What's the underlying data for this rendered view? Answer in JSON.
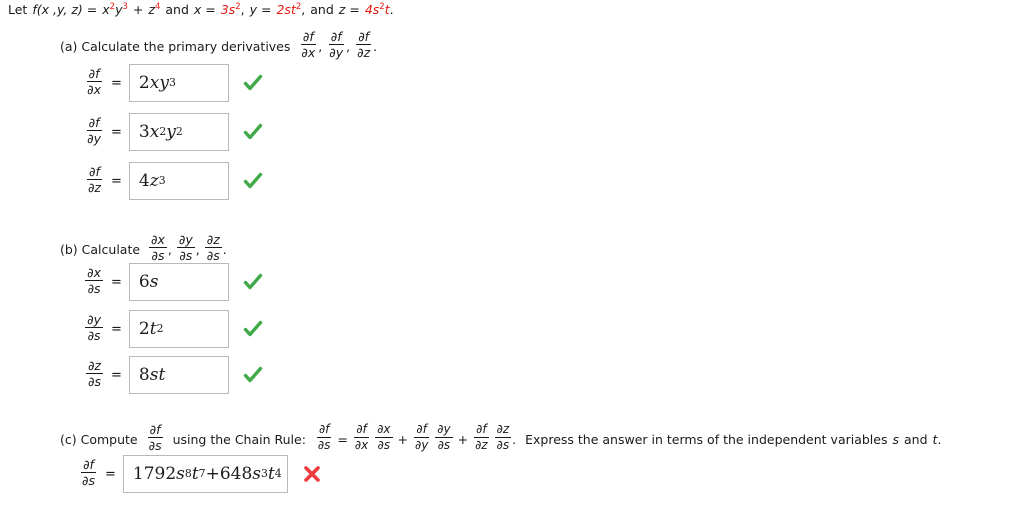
{
  "problem": {
    "statement": {
      "lead": "Let",
      "function_label": "f(x ,y, z) =",
      "function_expr_base1": "x",
      "function_expr_exp1": "2",
      "function_expr_base2": "y",
      "function_expr_exp2": "3",
      "plus": "+",
      "function_expr_base3": "z",
      "function_expr_exp3": "4",
      "and1": "and",
      "x_label": "x =",
      "x_value_coef": "3s",
      "x_value_exp": "2",
      "x_comma": ",",
      "y_label": "y =",
      "y_value_coef": "2st",
      "y_value_exp": "2",
      "y_comma": ",",
      "and2": "and",
      "z_label": "z =",
      "z_value_coef": "4s",
      "z_value_exp": "2",
      "z_value_tail": "t",
      "period": "."
    }
  },
  "parts": {
    "a": {
      "label": "(a) Calculate the primary derivatives",
      "targets": [
        {
          "num": "∂f",
          "den": "∂x",
          "sep": ","
        },
        {
          "num": "∂f",
          "den": "∂y",
          "sep": ","
        },
        {
          "num": "∂f",
          "den": "∂z",
          "sep": "."
        }
      ],
      "rows": [
        {
          "name": "df-dx",
          "num": "∂f",
          "den": "∂x",
          "equals": "=",
          "answer_plain": "2xy^3",
          "answer_coef": "2",
          "answer_var1": "xy",
          "answer_exp1": "3",
          "status": "correct"
        },
        {
          "name": "df-dy",
          "num": "∂f",
          "den": "∂y",
          "equals": "=",
          "answer_plain": "3x^2y^2",
          "answer_coef": "3",
          "answer_var1": "x",
          "answer_exp1": "2",
          "answer_var2": "y",
          "answer_exp2": "2",
          "status": "correct"
        },
        {
          "name": "df-dz",
          "num": "∂f",
          "den": "∂z",
          "equals": "=",
          "answer_plain": "4z^3",
          "answer_coef": "4",
          "answer_var1": "z",
          "answer_exp1": "3",
          "status": "correct"
        }
      ]
    },
    "b": {
      "label": "(b) Calculate",
      "targets": [
        {
          "num": "∂x",
          "den": "∂s",
          "sep": ","
        },
        {
          "num": "∂y",
          "den": "∂s",
          "sep": ","
        },
        {
          "num": "∂z",
          "den": "∂s",
          "sep": "."
        }
      ],
      "rows": [
        {
          "name": "dx-ds",
          "num": "∂x",
          "den": "∂s",
          "equals": "=",
          "answer_plain": "6s",
          "answer_coef": "6",
          "answer_var1": "s",
          "answer_exp1": "",
          "status": "correct"
        },
        {
          "name": "dy-ds",
          "num": "∂y",
          "den": "∂s",
          "equals": "=",
          "answer_plain": "2t^2",
          "answer_coef": "2",
          "answer_var1": "t",
          "answer_exp1": "2",
          "status": "correct"
        },
        {
          "name": "dz-ds",
          "num": "∂z",
          "den": "∂s",
          "equals": "=",
          "answer_plain": "8st",
          "answer_coef": "8",
          "answer_var1": "st",
          "answer_exp1": "",
          "status": "correct"
        }
      ]
    },
    "c": {
      "label_lead": "(c) Compute",
      "target": {
        "num": "∂f",
        "den": "∂s"
      },
      "label_mid": "using the Chain Rule:",
      "chain_rule": {
        "lhs": {
          "num": "∂f",
          "den": "∂s"
        },
        "equals": "=",
        "term1a": {
          "num": "∂f",
          "den": "∂x"
        },
        "term1b": {
          "num": "∂x",
          "den": "∂s"
        },
        "plus1": "+",
        "term2a": {
          "num": "∂f",
          "den": "∂y"
        },
        "term2b": {
          "num": "∂y",
          "den": "∂s"
        },
        "plus2": "+",
        "term3a": {
          "num": "∂f",
          "den": "∂z"
        },
        "term3b": {
          "num": "∂z",
          "den": "∂s"
        },
        "period": "."
      },
      "label_tail_pre": "Express the answer in terms of the independent variables",
      "var_s": "s",
      "label_and": "and",
      "var_t": "t",
      "label_tail_period": ".",
      "row": {
        "name": "df-ds",
        "num": "∂f",
        "den": "∂s",
        "equals": "=",
        "answer_plain": "1792s^8t^7 + 648s^3t^4",
        "answer_coef1": "1792",
        "answer_var1a": "s",
        "answer_exp1a": "8",
        "answer_var1b": "t",
        "answer_exp1b": "7",
        "answer_plus": "+",
        "answer_coef2": "648",
        "answer_var2a": "s",
        "answer_exp2a": "3",
        "answer_var2b": "t",
        "answer_exp2b": "4",
        "status": "incorrect"
      }
    }
  },
  "colors": {
    "accent_red": "#e8190f",
    "correct_green": "#3faa47",
    "incorrect_red": "#ee3b3b",
    "box_border": "#b9b9b9",
    "text": "#1a1a1a",
    "background": "#ffffff"
  },
  "icons": {
    "correct": "check-icon",
    "incorrect": "cross-icon"
  }
}
